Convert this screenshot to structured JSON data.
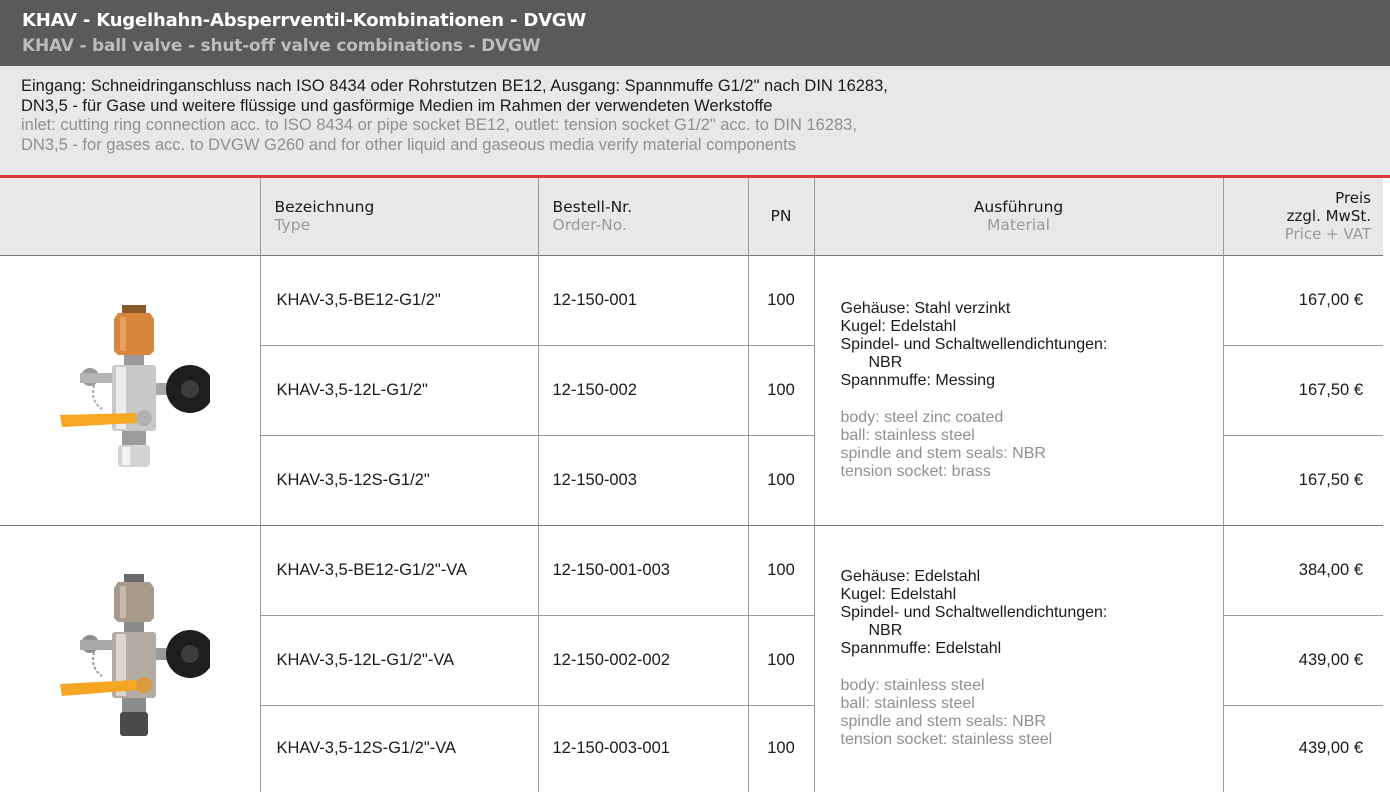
{
  "header": {
    "title_de": "KHAV - Kugelhahn-Absperrventil-Kombinationen - DVGW",
    "title_en": "KHAV - ball valve - shut-off valve combinations - DVGW"
  },
  "description": {
    "de_line1": "Eingang: Schneidringanschluss nach ISO 8434 oder Rohrstutzen BE12, Ausgang: Spannmuffe G1/2\" nach DIN 16283,",
    "de_line2": "DN3,5 - für Gase und weitere flüssige und gasförmige Medien im Rahmen der verwendeten Werkstoffe",
    "en_line1": "inlet: cutting ring connection acc. to ISO 8434 or pipe socket BE12, outlet: tension socket G1/2\" acc. to DIN 16283,",
    "en_line2": "DN3,5 - for gases acc. to DVGW G260 and for other liquid and gaseous media verify material components"
  },
  "columns": {
    "type_de": "Bezeichnung",
    "type_en": "Type",
    "order_de": "Bestell-Nr.",
    "order_en": "Order-No.",
    "pn": "PN",
    "material_de": "Ausführung",
    "material_en": "Material",
    "price_de1": "Preis",
    "price_de2": "zzgl. MwSt.",
    "price_en": "Price + VAT"
  },
  "groups": [
    {
      "image": "valve-brass-top-icon",
      "accent": "#c9853a",
      "material": {
        "de": [
          "Gehäuse: Stahl verzinkt",
          "Kugel: Edelstahl",
          "Spindel- und Schaltwellendichtungen:",
          "NBR",
          "Spannmuffe: Messing"
        ],
        "en": [
          "body: steel zinc coated",
          "ball: stainless steel",
          "spindle and stem seals: NBR",
          "tension socket: brass"
        ]
      },
      "rows": [
        {
          "type": "KHAV-3,5-BE12-G1/2\"",
          "order": "12-150-001",
          "pn": "100",
          "price": "167,00 €"
        },
        {
          "type": "KHAV-3,5-12L-G1/2\"",
          "order": "12-150-002",
          "pn": "100",
          "price": "167,50 €"
        },
        {
          "type": "KHAV-3,5-12S-G1/2\"",
          "order": "12-150-003",
          "pn": "100",
          "price": "167,50 €"
        }
      ]
    },
    {
      "image": "valve-stainless-icon",
      "accent": "#a89a8a",
      "material": {
        "de": [
          "Gehäuse: Edelstahl",
          "Kugel: Edelstahl",
          "Spindel- und Schaltwellendichtungen:",
          "NBR",
          "Spannmuffe: Edelstahl"
        ],
        "en": [
          "body: stainless steel",
          "ball: stainless steel",
          "spindle and stem seals: NBR",
          "tension socket: stainless steel"
        ]
      },
      "rows": [
        {
          "type": "KHAV-3,5-BE12-G1/2\"-VA",
          "order": "12-150-001-003",
          "pn": "100",
          "price": "384,00 €"
        },
        {
          "type": "KHAV-3,5-12L-G1/2\"-VA",
          "order": "12-150-002-002",
          "pn": "100",
          "price": "439,00 €"
        },
        {
          "type": "KHAV-3,5-12S-G1/2\"-VA",
          "order": "12-150-003-001",
          "pn": "100",
          "price": "439,00 €"
        }
      ]
    }
  ],
  "colors": {
    "title_bg": "#5a5a5a",
    "band_bg": "#e8e8e8",
    "accent_line": "#d93b3b",
    "handle": "#f5a623"
  }
}
